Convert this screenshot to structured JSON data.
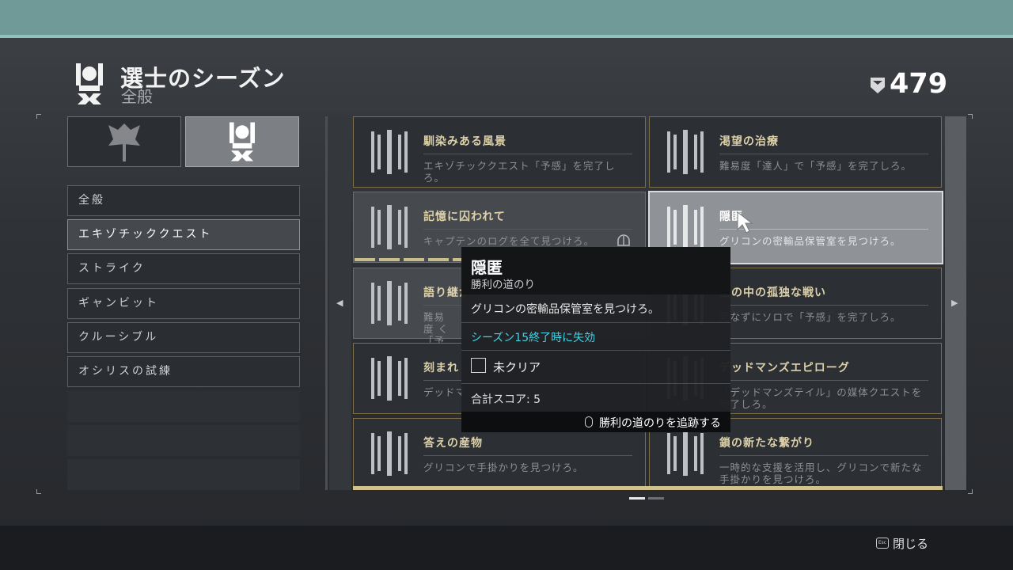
{
  "header": {
    "title": "選士のシーズン",
    "subtitle": "全般",
    "score": "479"
  },
  "categories": [
    {
      "name": "faction-emblem",
      "selected": false
    },
    {
      "name": "seal-emblem",
      "selected": true
    }
  ],
  "menu": {
    "items": [
      {
        "label": "全般",
        "active": false
      },
      {
        "label": "エキゾチッククエスト",
        "active": true
      },
      {
        "label": "ストライク",
        "active": false
      },
      {
        "label": "ギャンビット",
        "active": false
      },
      {
        "label": "クルーシブル",
        "active": false
      },
      {
        "label": "オシリスの試練",
        "active": false
      }
    ]
  },
  "cards": [
    {
      "title": "馴染みある風景",
      "desc": "エキゾチッククエスト「予感」を完了しろ。"
    },
    {
      "title": "渇望の治療",
      "desc": "難易度「達人」で「予感」を完了しろ。"
    },
    {
      "title": "記憶に囚われて",
      "desc": "キャプテンのログを全て見つけろ。"
    },
    {
      "title": "隠匿",
      "desc": "グリコンの密輸品保管室を見つけろ。"
    },
    {
      "title": "語り継が",
      "desc": "難易度 く「予感"
    },
    {
      "title": "闇の中の孤独な戦い",
      "desc": "死なずにソロで「予感」を完了しろ。"
    },
    {
      "title": "刻まれ",
      "desc": "デッドマ"
    },
    {
      "title": "デッドマンズエピローグ",
      "desc": "「デッドマンズテイル」の媒体クエストを完了しろ。"
    },
    {
      "title": "答えの産物",
      "desc": "グリコンで手掛かりを見つけろ。"
    },
    {
      "title": "鎖の新たな繋がり",
      "desc": "一時的な支援を活用し、グリコンで新たな手掛かりを見つけろ。"
    }
  ],
  "tooltip": {
    "title": "隠匿",
    "subtitle": "勝利の道のり",
    "description": "グリコンの密輸品保管室を見つけろ。",
    "expiry": "シーズン15終了時に失効",
    "status": "未クリア",
    "score_label": "合計スコア: 5",
    "track_label": "勝利の道のりを追跡する"
  },
  "footer": {
    "close_key": "Esc",
    "close_label": "閉じる"
  },
  "colors": {
    "accent_teal": "#6f9a98",
    "gold": "#ddd1a9",
    "expiry_cyan": "#3fd4e6"
  }
}
